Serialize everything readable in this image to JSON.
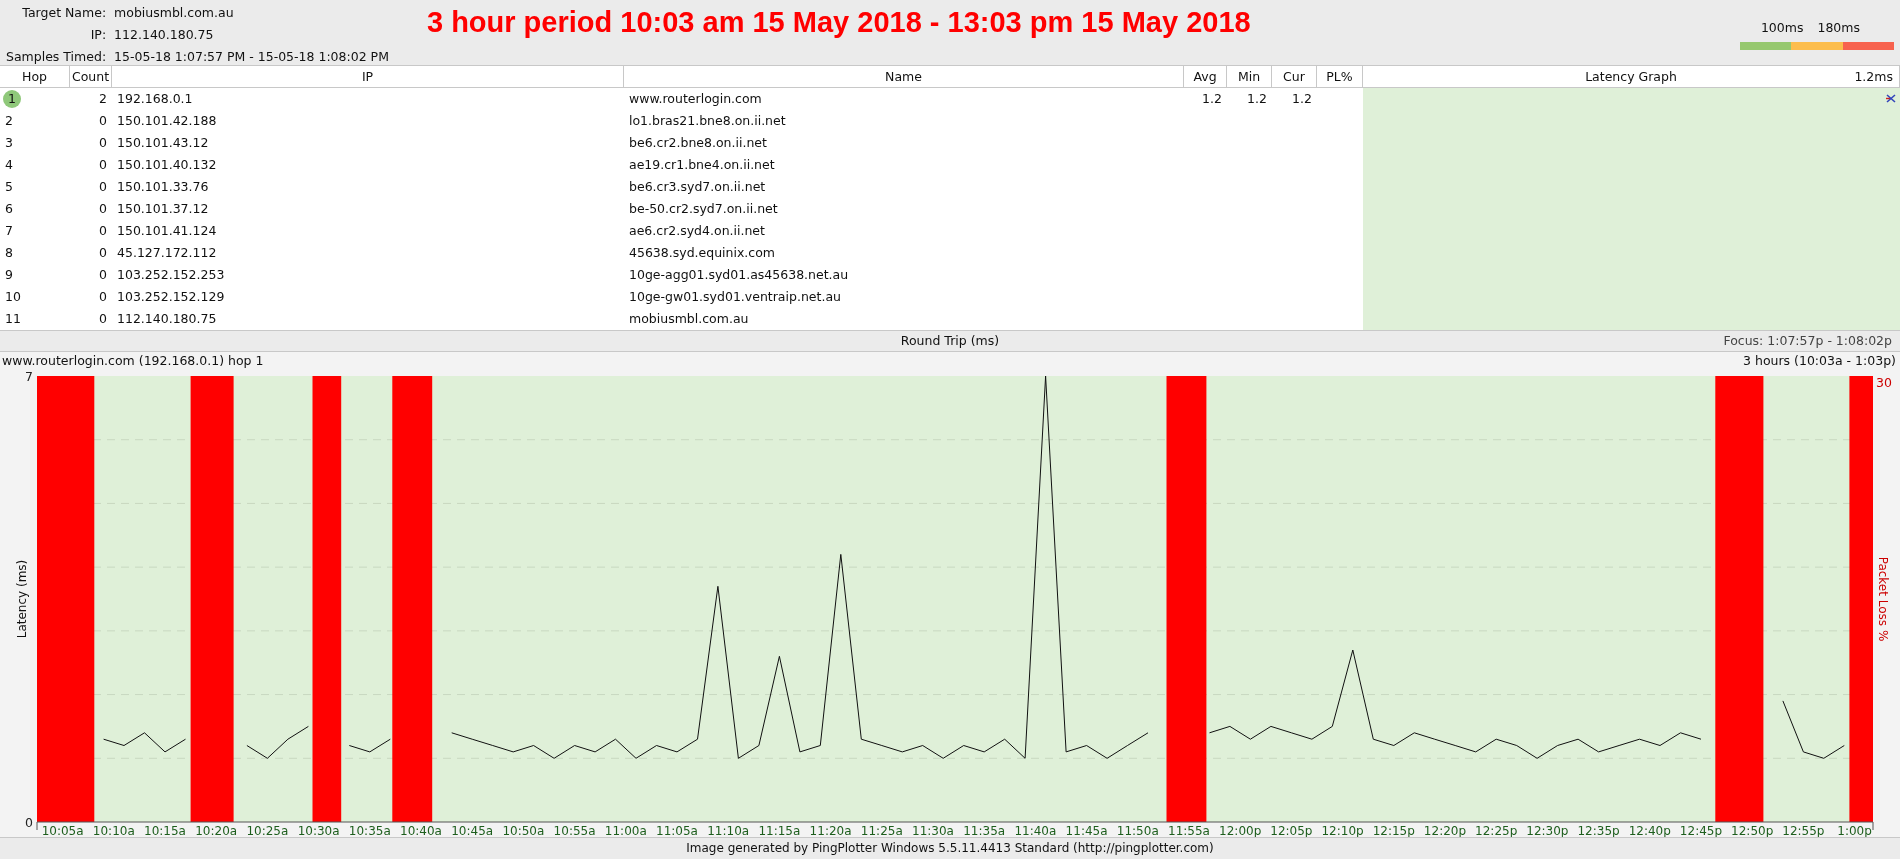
{
  "header": {
    "fields": [
      {
        "label": "Target Name:",
        "value": "mobiusmbl.com.au"
      },
      {
        "label": "IP:",
        "value": "112.140.180.75"
      },
      {
        "label": "Samples Timed:",
        "value": "15-05-18 1:07:57 PM - 15-05-18 1:08:02 PM"
      }
    ],
    "title": "3 hour period 10:03 am 15 May 2018 - 13:03 pm 15 May 2018",
    "scale": {
      "labels": [
        "100ms",
        "180ms"
      ],
      "segments": [
        {
          "color": "#96c86e"
        },
        {
          "color": "#fcbd4c"
        },
        {
          "color": "#f7624e"
        }
      ]
    }
  },
  "table": {
    "columns": [
      "Hop",
      "Count",
      "IP",
      "Name",
      "Avg",
      "Min",
      "Cur",
      "PL%",
      "Latency Graph"
    ],
    "graph_max": "1.2ms",
    "rows": [
      {
        "hop": "1",
        "count": "2",
        "ip": "192.168.0.1",
        "name": "www.routerlogin.com",
        "avg": "1.2",
        "min": "1.2",
        "cur": "1.2",
        "focused": true
      },
      {
        "hop": "2",
        "count": "0",
        "ip": "150.101.42.188",
        "name": "lo1.bras21.bne8.on.ii.net",
        "focused": false
      },
      {
        "hop": "3",
        "count": "0",
        "ip": "150.101.43.12",
        "name": "be6.cr2.bne8.on.ii.net",
        "focused": false
      },
      {
        "hop": "4",
        "count": "0",
        "ip": "150.101.40.132",
        "name": "ae19.cr1.bne4.on.ii.net",
        "focused": false
      },
      {
        "hop": "5",
        "count": "0",
        "ip": "150.101.33.76",
        "name": "be6.cr3.syd7.on.ii.net",
        "focused": false
      },
      {
        "hop": "6",
        "count": "0",
        "ip": "150.101.37.12",
        "name": "be-50.cr2.syd7.on.ii.net",
        "focused": false
      },
      {
        "hop": "7",
        "count": "0",
        "ip": "150.101.41.124",
        "name": "ae6.cr2.syd4.on.ii.net",
        "focused": false
      },
      {
        "hop": "8",
        "count": "0",
        "ip": "45.127.172.112",
        "name": "45638.syd.equinix.com",
        "focused": false
      },
      {
        "hop": "9",
        "count": "0",
        "ip": "103.252.152.253",
        "name": "10ge-agg01.syd01.as45638.net.au",
        "focused": false
      },
      {
        "hop": "10",
        "count": "0",
        "ip": "103.252.152.129",
        "name": "10ge-gw01.syd01.ventraip.net.au",
        "focused": false
      },
      {
        "hop": "11",
        "count": "0",
        "ip": "112.140.180.75",
        "name": "mobiusmbl.com.au",
        "focused": false
      }
    ]
  },
  "round_trip": {
    "title": "Round Trip (ms)",
    "focus": "Focus: 1:07:57p - 1:08:02p",
    "target_label": "www.routerlogin.com (192.168.0.1) hop 1",
    "range": "3 hours (10:03a - 1:03p)",
    "loss_scale_label": "30",
    "chart_data": {
      "type": "line",
      "ylim": [
        0,
        7
      ],
      "yticks": [
        0,
        7
      ],
      "y2label": "Packet Loss %",
      "bands": [
        {
          "axis": "x",
          "from": 602.5,
          "to": 608.1,
          "color": "#ff0000"
        },
        {
          "axis": "x",
          "from": 617.5,
          "to": 621.7,
          "color": "#ff0000"
        },
        {
          "axis": "x",
          "from": 629.4,
          "to": 632.2,
          "color": "#ff0000"
        },
        {
          "axis": "x",
          "from": 637.2,
          "to": 641.1,
          "color": "#ff0000"
        },
        {
          "axis": "x",
          "from": 712.8,
          "to": 716.7,
          "color": "#ff0000"
        },
        {
          "axis": "x",
          "from": 766.4,
          "to": 771.1,
          "color": "#ff0000"
        },
        {
          "axis": "x",
          "from": 779.5,
          "to": 781.8,
          "color": "#ff0000"
        }
      ],
      "xlim": [
        602.5,
        781.8
      ],
      "x": [
        609,
        611,
        613,
        615,
        617,
        619,
        621,
        623,
        625,
        627,
        629,
        631,
        633,
        635,
        637,
        639,
        641,
        643,
        645,
        647,
        649,
        651,
        653,
        655,
        657,
        659,
        661,
        663,
        665,
        667,
        669,
        671,
        673,
        675,
        677,
        679,
        681,
        683,
        685,
        687,
        689,
        691,
        693,
        695,
        697,
        699,
        701,
        703,
        705,
        707,
        709,
        711,
        713,
        715,
        717,
        719,
        721,
        723,
        725,
        727,
        729,
        731,
        733,
        735,
        737,
        739,
        741,
        743,
        745,
        747,
        749,
        751,
        753,
        755,
        757,
        759,
        761,
        763,
        765,
        767,
        769,
        771,
        773,
        775,
        777,
        779
      ],
      "xticks": [
        {
          "value": 605,
          "label": "10:05a"
        },
        {
          "value": 610,
          "label": "10:10a"
        },
        {
          "value": 615,
          "label": "10:15a"
        },
        {
          "value": 620,
          "label": "10:20a"
        },
        {
          "value": 625,
          "label": "10:25a"
        },
        {
          "value": 630,
          "label": "10:30a"
        },
        {
          "value": 635,
          "label": "10:35a"
        },
        {
          "value": 640,
          "label": "10:40a"
        },
        {
          "value": 645,
          "label": "10:45a"
        },
        {
          "value": 650,
          "label": "10:50a"
        },
        {
          "value": 655,
          "label": "10:55a"
        },
        {
          "value": 660,
          "label": "11:00a"
        },
        {
          "value": 665,
          "label": "11:05a"
        },
        {
          "value": 670,
          "label": "11:10a"
        },
        {
          "value": 675,
          "label": "11:15a"
        },
        {
          "value": 680,
          "label": "11:20a"
        },
        {
          "value": 685,
          "label": "11:25a"
        },
        {
          "value": 690,
          "label": "11:30a"
        },
        {
          "value": 695,
          "label": "11:35a"
        },
        {
          "value": 700,
          "label": "11:40a"
        },
        {
          "value": 705,
          "label": "11:45a"
        },
        {
          "value": 710,
          "label": "11:50a"
        },
        {
          "value": 715,
          "label": "11:55a"
        },
        {
          "value": 720,
          "label": "12:00p"
        },
        {
          "value": 725,
          "label": "12:05p"
        },
        {
          "value": 730,
          "label": "12:10p"
        },
        {
          "value": 735,
          "label": "12:15p"
        },
        {
          "value": 740,
          "label": "12:20p"
        },
        {
          "value": 745,
          "label": "12:25p"
        },
        {
          "value": 750,
          "label": "12:30p"
        },
        {
          "value": 755,
          "label": "12:35p"
        },
        {
          "value": 760,
          "label": "12:40p"
        },
        {
          "value": 765,
          "label": "12:45p"
        },
        {
          "value": 770,
          "label": "12:50p"
        },
        {
          "value": 775,
          "label": "12:55p"
        },
        {
          "value": 780,
          "label": "1:00p"
        }
      ],
      "series": [
        {
          "name": "Latency (ms)",
          "color": "#111111",
          "values": [
            1.3,
            1.2,
            1.4,
            1.1,
            1.3,
            null,
            null,
            1.2,
            1.0,
            1.3,
            1.5,
            null,
            1.2,
            1.1,
            1.3,
            null,
            null,
            1.4,
            1.3,
            1.2,
            1.1,
            1.2,
            1.0,
            1.2,
            1.1,
            1.3,
            1.0,
            1.2,
            1.1,
            1.3,
            3.7,
            1.0,
            1.2,
            2.6,
            1.1,
            1.2,
            4.2,
            1.3,
            1.2,
            1.1,
            1.2,
            1.0,
            1.2,
            1.1,
            1.3,
            1.0,
            7.0,
            1.1,
            1.2,
            1.0,
            1.2,
            1.4,
            null,
            null,
            1.4,
            1.5,
            1.3,
            1.5,
            1.4,
            1.3,
            1.5,
            2.7,
            1.3,
            1.2,
            1.4,
            1.3,
            1.2,
            1.1,
            1.3,
            1.2,
            1.0,
            1.2,
            1.3,
            1.1,
            1.2,
            1.3,
            1.2,
            1.4,
            1.3,
            null,
            null,
            null,
            1.9,
            1.1,
            1.0,
            1.2
          ]
        }
      ]
    }
  },
  "footer": "Image generated by PingPlotter Windows 5.5.11.4413 Standard (http://pingplotter.com)"
}
